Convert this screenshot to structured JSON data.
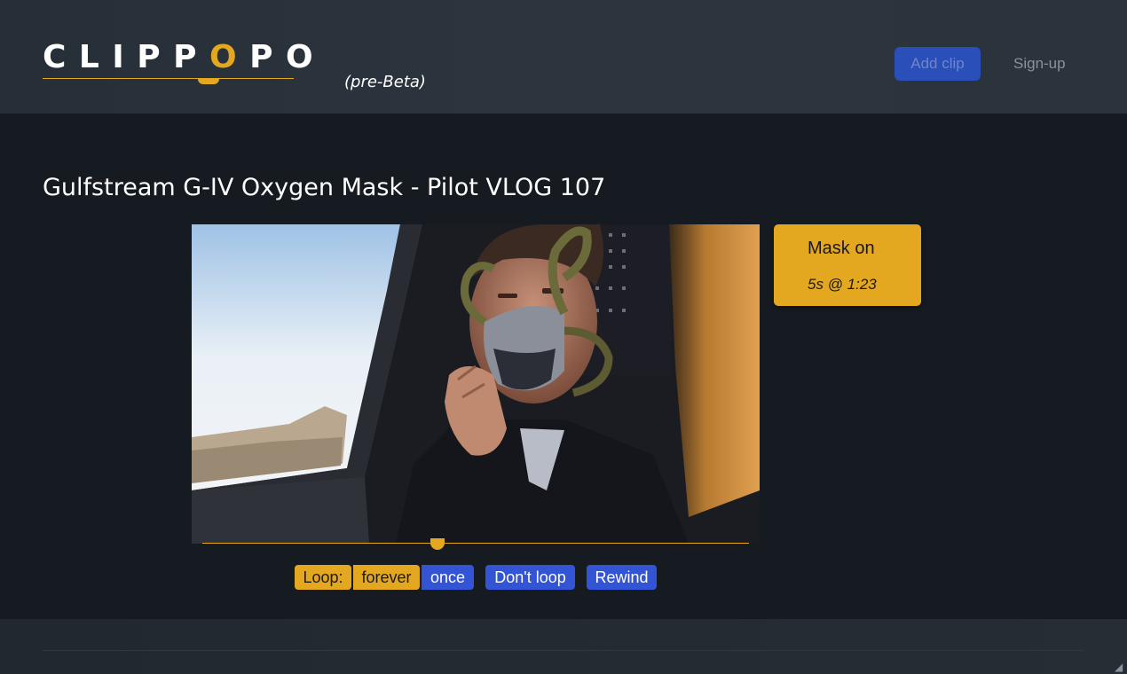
{
  "header": {
    "logo_text": "CLIPPOPO",
    "logo_tag": "(pre-Beta)",
    "add_clip_label": "Add clip",
    "signup_label": "Sign-up"
  },
  "page": {
    "title": "Gulfstream G-IV Oxygen Mask - Pilot VLOG 107"
  },
  "clip": {
    "name": "Mask on",
    "meta": "5s @ 1:23"
  },
  "controls": {
    "loop_label": "Loop:",
    "forever_label": "forever",
    "once_label": "once",
    "dont_loop_label": "Don't loop",
    "rewind_label": "Rewind"
  },
  "playback": {
    "position_fraction": 0.43
  },
  "colors": {
    "accent": "#e3a820",
    "primary_button": "#3354d4",
    "header_bg": "#2c343e",
    "page_bg": "#161b21"
  }
}
